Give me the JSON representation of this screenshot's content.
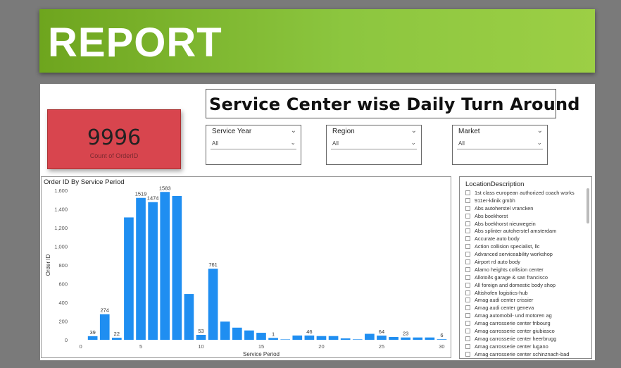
{
  "banner": {
    "title": "REPORT"
  },
  "page_title": "Service Center wise Daily Turn  Around",
  "kpi": {
    "value": "9996",
    "label": "Count of OrderID"
  },
  "slicers": [
    {
      "title": "Service Year",
      "value": "All"
    },
    {
      "title": "Region",
      "value": "All"
    },
    {
      "title": "Market",
      "value": "All"
    }
  ],
  "chart": {
    "title": "Order ID By Service Period"
  },
  "chart_data": {
    "type": "bar",
    "xlabel": "Service Period",
    "ylabel": "Order ID",
    "ylim": [
      0,
      1600
    ],
    "xlim": [
      0,
      30
    ],
    "yticks": [
      0,
      200,
      400,
      600,
      800,
      1000,
      1200,
      1400,
      1600
    ],
    "ytick_labels": [
      "0",
      "200",
      "400",
      "600",
      "800",
      "1,000",
      "1,200",
      "1,400",
      "1,600"
    ],
    "xticks": [
      0,
      5,
      10,
      15,
      20,
      25,
      30
    ],
    "x": [
      1,
      2,
      3,
      4,
      5,
      6,
      7,
      8,
      9,
      10,
      11,
      12,
      13,
      14,
      15,
      16,
      17,
      18,
      19,
      20,
      21,
      22,
      23,
      24,
      25,
      26,
      27,
      28,
      29,
      30
    ],
    "values": [
      39,
      274,
      22,
      1310,
      1519,
      1474,
      1583,
      1540,
      490,
      53,
      761,
      195,
      130,
      100,
      75,
      20,
      1,
      46,
      46,
      40,
      40,
      15,
      5,
      64,
      45,
      30,
      25,
      25,
      25,
      6
    ],
    "data_labels": [
      {
        "x": 1,
        "label": "39"
      },
      {
        "x": 2,
        "label": "274"
      },
      {
        "x": 3,
        "label": "22"
      },
      {
        "x": 5,
        "label": "1519"
      },
      {
        "x": 6,
        "label": "1474"
      },
      {
        "x": 7,
        "label": "1583"
      },
      {
        "x": 10,
        "label": "53"
      },
      {
        "x": 11,
        "label": "761"
      },
      {
        "x": 16,
        "label": "1"
      },
      {
        "x": 19,
        "label": "46"
      },
      {
        "x": 25,
        "label": "64"
      },
      {
        "x": 27,
        "label": "23"
      },
      {
        "x": 30,
        "label": "6"
      }
    ],
    "bar_color": "#1f8ef1",
    "grid": false
  },
  "location_list": {
    "title": "LocationDescription",
    "items": [
      "1st class european authorized coach works",
      "911er-klinik gmbh",
      "Abs autoherstel vrancken",
      "Abs boekhorst",
      "Abs boekhorst nieuwegein",
      "Abs splinter autoherstel amsterdam",
      "Accurate auto body",
      "Action collision specialist, llc",
      "Advanced serviceability workshop",
      "Airport rd auto body",
      "Alamo heights collision center",
      "Allotoðs garage & san francisco",
      "All foreign and domestic body shop",
      "Altishofen logistics-hub",
      "Amag audi center crissier",
      "Amag audi center geneva",
      "Amag automobil- und motoren ag",
      "Amag carrosserie center fribourg",
      "Amag carrosserie center giubiasco",
      "Amag carrosserie center heerbrugg",
      "Amag carrosserie center lugano",
      "Amag carrosserie center schinznach-bad"
    ]
  },
  "colors": {
    "banner": "#8cc63f",
    "kpi_bg": "#d8454e",
    "bar": "#1f8ef1",
    "background": "#7a7a7a"
  }
}
